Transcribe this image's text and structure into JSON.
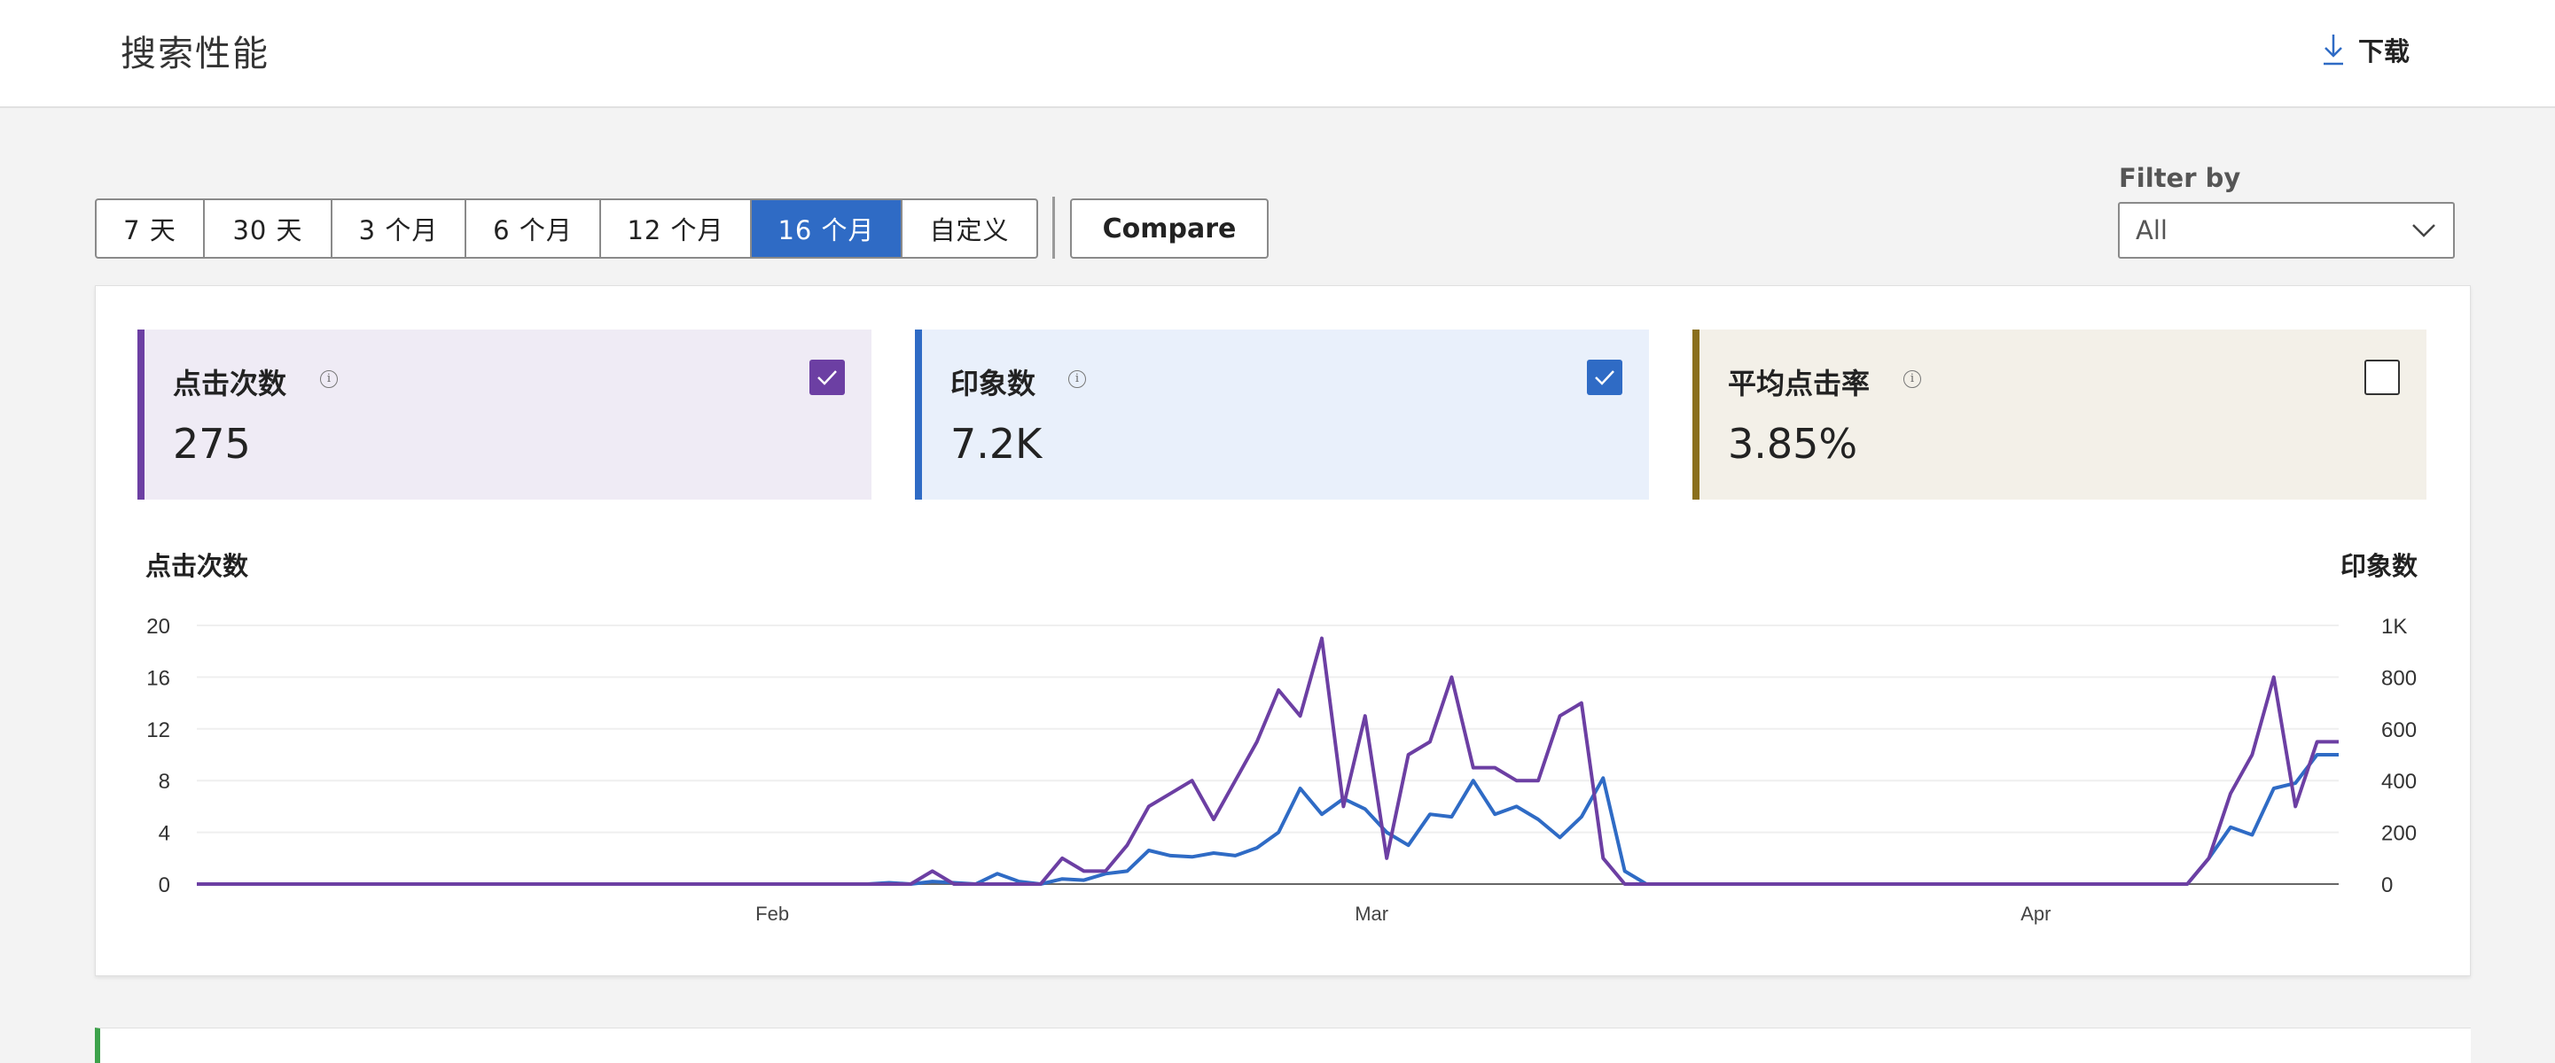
{
  "header": {
    "title": "搜索性能",
    "download_label": "下载"
  },
  "date_ranges": [
    {
      "label": "7 天",
      "active": false
    },
    {
      "label": "30 天",
      "active": false
    },
    {
      "label": "3 个月",
      "active": false
    },
    {
      "label": "6 个月",
      "active": false
    },
    {
      "label": "12 个月",
      "active": false
    },
    {
      "label": "16 个月",
      "active": true
    },
    {
      "label": "自定义",
      "active": false
    }
  ],
  "compare_label": "Compare",
  "filter": {
    "label": "Filter by",
    "value": "All"
  },
  "metrics": [
    {
      "label": "点击次数",
      "value": "275",
      "checked": true,
      "accent": "#6c3fa3",
      "bg": "#efebf5"
    },
    {
      "label": "印象数",
      "value": "7.2K",
      "checked": true,
      "accent": "#2f6bc5",
      "bg": "#e9f0fb"
    },
    {
      "label": "平均点击率",
      "value": "3.85%",
      "checked": false,
      "accent": "#8a6f1c",
      "bg": "#f3f0e8"
    }
  ],
  "icons": {
    "download": "download-icon",
    "info": "info-icon",
    "check": "check-icon",
    "dropdown": "chevron-down-icon"
  },
  "chart_data": {
    "type": "line",
    "x_tick_labels": [
      "Feb",
      "Mar",
      "Apr"
    ],
    "y_left": {
      "label": "点击次数",
      "ticks": [
        "0",
        "4",
        "8",
        "12",
        "16",
        "20"
      ],
      "range": [
        0,
        20
      ]
    },
    "y_right": {
      "label": "印象数",
      "ticks": [
        "0",
        "200",
        "400",
        "600",
        "800",
        "1K"
      ],
      "range": [
        0,
        1000
      ]
    },
    "x_range": [
      0,
      99
    ],
    "x_tick_positions": [
      26.6,
      54.3,
      85.0
    ],
    "grid": true,
    "series": [
      {
        "axis": "left",
        "color": "#6c3fa3",
        "values": [
          0,
          0,
          0,
          0,
          0,
          0,
          0,
          0,
          0,
          0,
          0,
          0,
          0,
          0,
          0,
          0,
          0,
          0,
          0,
          0,
          0,
          0,
          0,
          0,
          0,
          0,
          0,
          0,
          0,
          0,
          0,
          0,
          0,
          0,
          1,
          0,
          0,
          0,
          0,
          0,
          2,
          1,
          1,
          3,
          6,
          7,
          8,
          5,
          8,
          11,
          15,
          13,
          19,
          6,
          13,
          2,
          10,
          11,
          16,
          9,
          9,
          8,
          8,
          13,
          14,
          2,
          0,
          0,
          0,
          0,
          0,
          0,
          0,
          0,
          0,
          0,
          0,
          0,
          0,
          0,
          0,
          0,
          0,
          0,
          0,
          0,
          0,
          0,
          0,
          0,
          0,
          0,
          0,
          2,
          7,
          10,
          16,
          6,
          11,
          11
        ]
      },
      {
        "axis": "right",
        "color": "#2f6bc5",
        "values": [
          0,
          0,
          0,
          0,
          0,
          0,
          0,
          0,
          0,
          0,
          0,
          0,
          0,
          0,
          0,
          0,
          0,
          0,
          0,
          0,
          0,
          0,
          0,
          0,
          0,
          0,
          0,
          0,
          0,
          0,
          0,
          0,
          5,
          0,
          10,
          5,
          0,
          40,
          10,
          0,
          20,
          15,
          40,
          50,
          130,
          110,
          105,
          120,
          110,
          140,
          200,
          370,
          270,
          330,
          290,
          200,
          150,
          270,
          260,
          400,
          270,
          300,
          250,
          180,
          260,
          410,
          50,
          0,
          0,
          0,
          0,
          0,
          0,
          0,
          0,
          0,
          0,
          0,
          0,
          0,
          0,
          0,
          0,
          0,
          0,
          0,
          0,
          0,
          0,
          0,
          0,
          0,
          0,
          100,
          220,
          190,
          370,
          390,
          500,
          500
        ]
      }
    ]
  }
}
